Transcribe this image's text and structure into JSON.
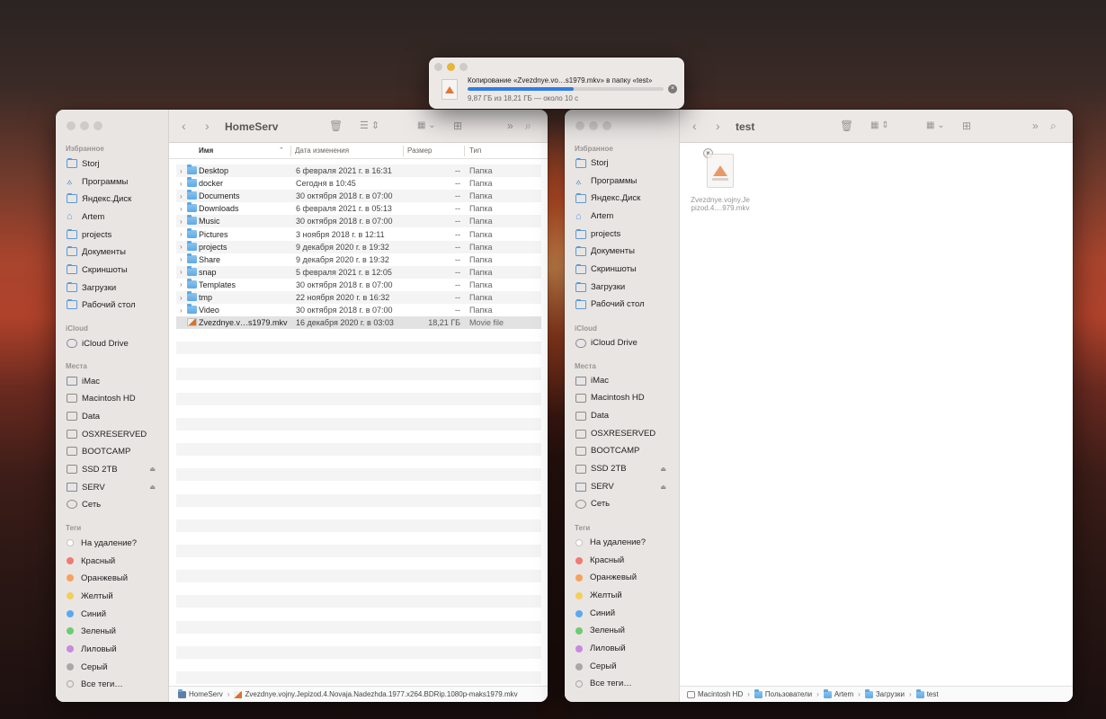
{
  "copy_dialog": {
    "message": "Копирование «Zvezdnye.vo…s1979.mkv» в папку «test»",
    "progress_text": "9,87 ГБ из 18,21 ГБ — около 10 с",
    "progress": 0.54
  },
  "left_window": {
    "title": "HomeServ",
    "columns": {
      "name": "Имя",
      "date": "Дата изменения",
      "size": "Размер",
      "type": "Тип"
    },
    "rows": [
      {
        "name": "Desktop",
        "date": "6 февраля 2021 г. в 16:31",
        "size": "--",
        "type": "Папка"
      },
      {
        "name": "docker",
        "date": "Сегодня в 10:45",
        "size": "--",
        "type": "Папка"
      },
      {
        "name": "Documents",
        "date": "30 октября 2018 г. в 07:00",
        "size": "--",
        "type": "Папка"
      },
      {
        "name": "Downloads",
        "date": "6 февраля 2021 г. в 05:13",
        "size": "--",
        "type": "Папка"
      },
      {
        "name": "Music",
        "date": "30 октября 2018 г. в 07:00",
        "size": "--",
        "type": "Папка"
      },
      {
        "name": "Pictures",
        "date": "3 ноября 2018 г. в 12:11",
        "size": "--",
        "type": "Папка"
      },
      {
        "name": "projects",
        "date": "9 декабря 2020 г. в 19:32",
        "size": "--",
        "type": "Папка"
      },
      {
        "name": "Share",
        "date": "9 декабря 2020 г. в 19:32",
        "size": "--",
        "type": "Папка"
      },
      {
        "name": "snap",
        "date": "5 февраля 2021 г. в 12:05",
        "size": "--",
        "type": "Папка"
      },
      {
        "name": "Templates",
        "date": "30 октября 2018 г. в 07:00",
        "size": "--",
        "type": "Папка"
      },
      {
        "name": "tmp",
        "date": "22 ноября 2020 г. в 16:32",
        "size": "--",
        "type": "Папка"
      },
      {
        "name": "Video",
        "date": "30 октября 2018 г. в 07:00",
        "size": "--",
        "type": "Папка"
      },
      {
        "name": "Zvezdnye.v…s1979.mkv",
        "date": "16 декабря 2020 г. в 03:03",
        "size": "18,21 ГБ",
        "type": "Movie file"
      }
    ],
    "pathbar": {
      "root": "HomeServ",
      "file": "Zvezdnye.vojny.Jepizod.4.Novaja.Nadezhda.1977.x264.BDRip.1080p-maks1979.mkv"
    }
  },
  "right_window": {
    "title": "test",
    "file_label_line1": "Zvezdnye.vojny.Je",
    "file_label_line2": "pizod.4....979.mkv",
    "pathbar": [
      "Macintosh HD",
      "Пользователи",
      "Artem",
      "Загрузки",
      "test"
    ]
  },
  "sidebar": {
    "favorites_header": "Избранное",
    "favorites": [
      "Storj",
      "Программы",
      "Яндекс.Диск",
      "Artem",
      "projects",
      "Документы",
      "Скриншоты",
      "Загрузки",
      "Рабочий стол"
    ],
    "icloud_header": "iCloud",
    "icloud": [
      "iCloud Drive"
    ],
    "locations_header": "Места",
    "locations": [
      "iMac",
      "Macintosh HD",
      "Data",
      "OSXRESERVED",
      "BOOTCAMP",
      "SSD 2TB",
      "SERV",
      "Сеть"
    ],
    "tags_header": "Теги",
    "tags": [
      {
        "label": "На удаление?",
        "color": "#ffffff"
      },
      {
        "label": "Красный",
        "color": "#f07a74"
      },
      {
        "label": "Оранжевый",
        "color": "#f5a25c"
      },
      {
        "label": "Желтый",
        "color": "#f2cf5b"
      },
      {
        "label": "Синий",
        "color": "#5aa9ee"
      },
      {
        "label": "Зеленый",
        "color": "#6ccc73"
      },
      {
        "label": "Лиловый",
        "color": "#c78ade"
      },
      {
        "label": "Серый",
        "color": "#a8a8a8"
      },
      {
        "label": "Все теги…",
        "color": ""
      }
    ]
  },
  "icons": {
    "folder": "folder-icon",
    "file": "video-file-icon",
    "trash": "trash-icon",
    "search": "search-icon"
  }
}
